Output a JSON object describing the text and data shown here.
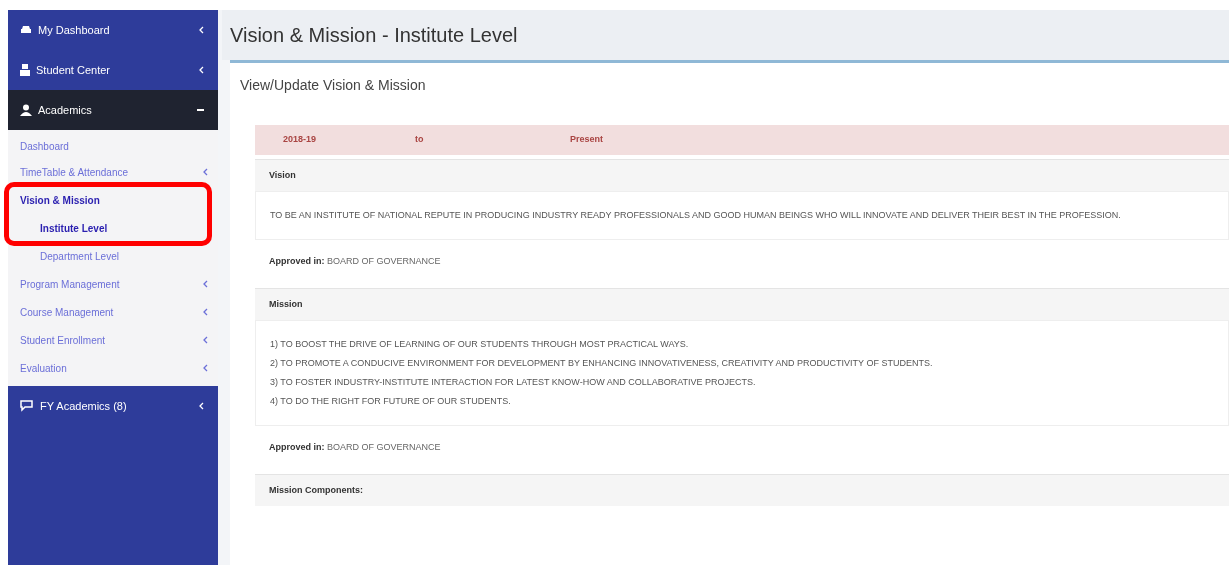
{
  "sidebar": {
    "items": [
      {
        "label": "My Dashboard",
        "expanded": false,
        "selected": false
      },
      {
        "label": "Student Center",
        "expanded": false,
        "selected": false
      },
      {
        "label": "Academics",
        "expanded": true,
        "selected": true,
        "children": [
          {
            "label": "Dashboard",
            "selected": false,
            "has_submenu": false
          },
          {
            "label": "TimeTable & Attendance",
            "selected": false,
            "has_submenu": true
          },
          {
            "label": "Vision & Mission",
            "selected": true,
            "has_submenu": false,
            "children": [
              {
                "label": "Institute Level",
                "selected": true
              },
              {
                "label": "Department Level",
                "selected": false
              }
            ]
          },
          {
            "label": "Program Management",
            "selected": false,
            "has_submenu": true
          },
          {
            "label": "Course Management",
            "selected": false,
            "has_submenu": true
          },
          {
            "label": "Student Enrollment",
            "selected": false,
            "has_submenu": true
          },
          {
            "label": "Evaluation",
            "selected": false,
            "has_submenu": true
          }
        ]
      },
      {
        "label": "FY Academics (8)",
        "expanded": false,
        "selected": false
      }
    ]
  },
  "page": {
    "title": "Vision & Mission - Institute Level",
    "subtitle": "View/Update Vision & Mission"
  },
  "period": {
    "from": "2018-19",
    "separator": "to",
    "to": "Present"
  },
  "sections": [
    {
      "kind": "heading",
      "text": "Vision"
    },
    {
      "kind": "body",
      "lines": [
        "TO BE AN INSTITUTE OF NATIONAL REPUTE IN PRODUCING INDUSTRY READY PROFESSIONALS AND GOOD HUMAN BEINGS WHO WILL INNOVATE AND DELIVER THEIR BEST IN THE PROFESSION."
      ]
    },
    {
      "kind": "approved",
      "text": "**Approved in:** BOARD OF GOVERNANCE"
    },
    {
      "kind": "heading",
      "text": "Mission"
    },
    {
      "kind": "body",
      "lines": [
        "1) TO BOOST THE DRIVE OF LEARNING OF OUR STUDENTS THROUGH MOST PRACTICAL WAYS.",
        "2) TO PROMOTE A CONDUCIVE ENVIRONMENT FOR DEVELOPMENT BY ENHANCING INNOVATIVENESS, CREATIVITY AND PRODUCTIVITY OF STUDENTS.",
        "3) TO FOSTER INDUSTRY-INSTITUTE INTERACTION FOR LATEST KNOW-HOW AND COLLABORATIVE PROJECTS.",
        "4) TO DO THE RIGHT FOR FUTURE OF OUR STUDENTS."
      ]
    },
    {
      "kind": "approved",
      "text": "**Approved in:** BOARD OF GOVERNANCE"
    },
    {
      "kind": "heading",
      "text": "Mission Components:"
    }
  ],
  "annotation": {
    "kind": "highlight-box"
  }
}
